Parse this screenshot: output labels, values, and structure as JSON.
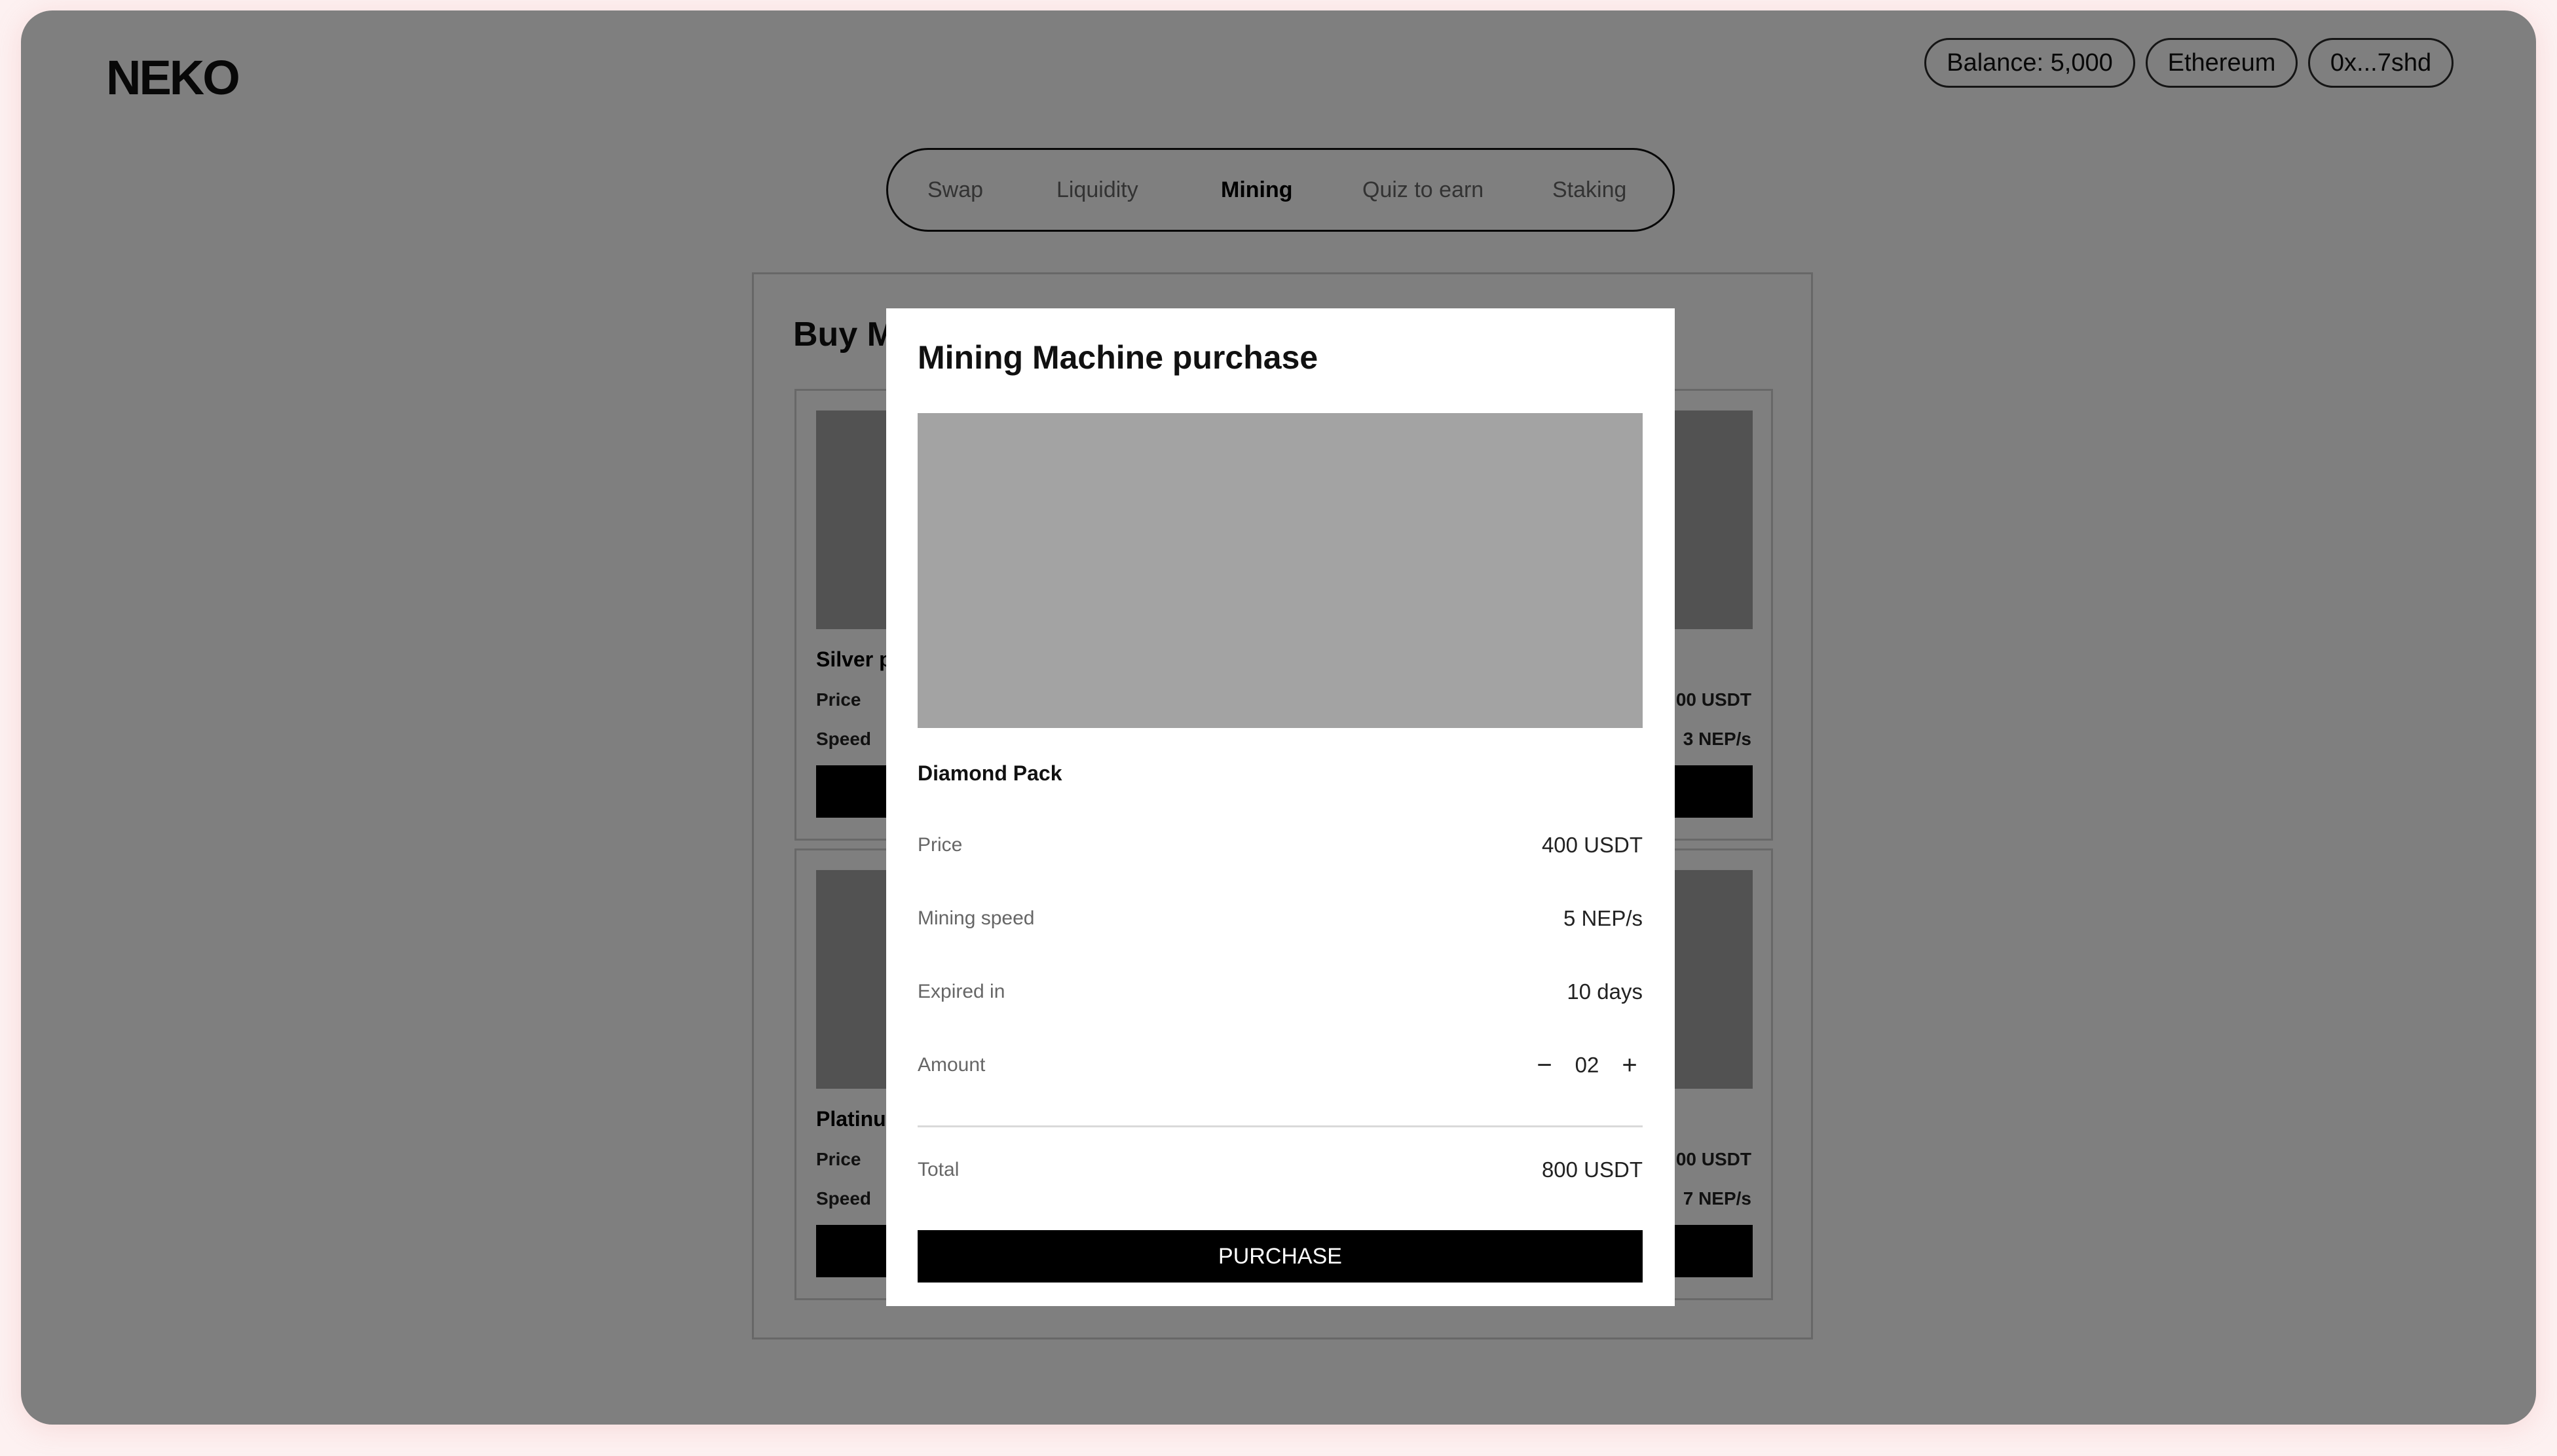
{
  "brand": {
    "logo": "NEKO"
  },
  "header": {
    "balance": "Balance: 5,000",
    "network": "Ethereum",
    "wallet": "0x...7shd"
  },
  "nav": {
    "tabs": [
      {
        "label": "Swap",
        "active": false
      },
      {
        "label": "Liquidity",
        "active": false
      },
      {
        "label": "Mining",
        "active": true
      },
      {
        "label": "Quiz to earn",
        "active": false
      },
      {
        "label": "Staking",
        "active": false
      }
    ]
  },
  "panel": {
    "title": "Buy M",
    "cards": [
      {
        "name": "Silver p",
        "price_label": "Price",
        "price_value": "00 USDT",
        "speed_label": "Speed",
        "speed_value": "3 NEP/s"
      },
      {
        "name": "Platinu",
        "price_label": "Price",
        "price_value": "00 USDT",
        "speed_label": "Speed",
        "speed_value": "7 NEP/s"
      }
    ]
  },
  "modal": {
    "title": "Mining Machine purchase",
    "pack_name": "Diamond Pack",
    "price_label": "Price",
    "price_value": "400 USDT",
    "speed_label": "Mining speed",
    "speed_value": "5 NEP/s",
    "expiry_label": "Expired in",
    "expiry_value": "10 days",
    "amount_label": "Amount",
    "amount_minus": "−",
    "amount_value": "02",
    "amount_plus": "+",
    "total_label": "Total",
    "total_value": "800 USDT",
    "purchase_label": "PURCHASE"
  }
}
